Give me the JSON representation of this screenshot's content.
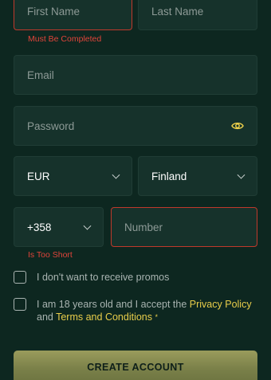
{
  "form": {
    "first_name": {
      "placeholder": "First Name",
      "error": "Must Be Completed"
    },
    "last_name": {
      "placeholder": "Last Name"
    },
    "email": {
      "placeholder": "Email"
    },
    "password": {
      "placeholder": "Password",
      "icon": "eye-icon"
    },
    "currency": {
      "value": "EUR",
      "icon": "chevron-down-icon"
    },
    "country": {
      "value": "Finland",
      "icon": "chevron-down-icon"
    },
    "phone_code": {
      "value": "+358",
      "icon": "chevron-down-icon"
    },
    "phone_number": {
      "placeholder": "Number",
      "error": "Is Too Short"
    },
    "promos_checkbox": {
      "label": "I don't want to receive promos"
    },
    "terms_checkbox": {
      "text_before": "I am 18 years old and I accept the ",
      "privacy_link": "Privacy Policy",
      "text_and": "and ",
      "terms_link": "Terms and Conditions",
      "required_mark": "*"
    },
    "submit_label": "CREATE ACCOUNT"
  },
  "colors": {
    "background": "#0d2720",
    "field": "#16322b",
    "error": "#e0443a",
    "accent": "#e8cd4a"
  }
}
